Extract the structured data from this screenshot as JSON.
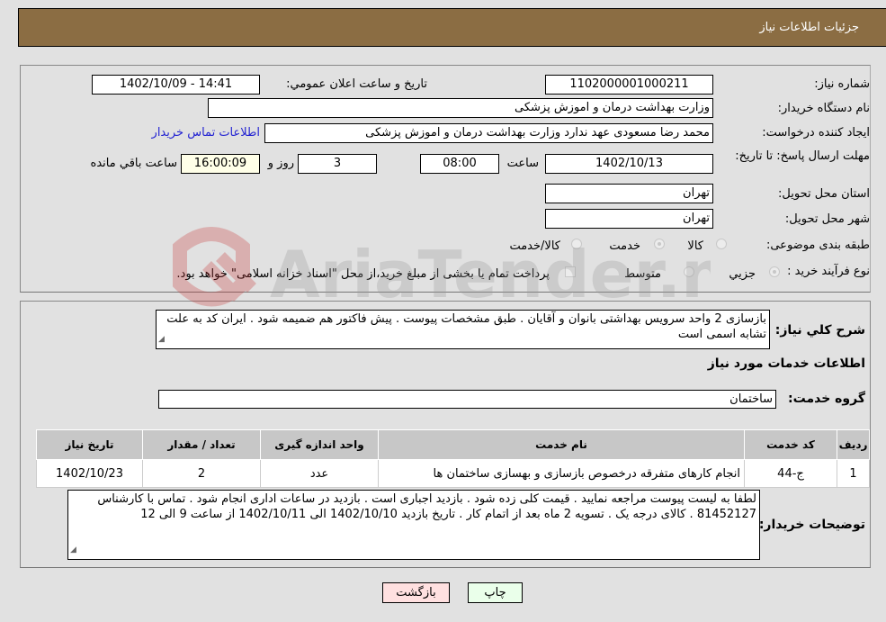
{
  "header": {
    "title": "جزئیات اطلاعات نیاز"
  },
  "form": {
    "need_number": {
      "label": "شماره نیاز:",
      "value": "1102000001000211"
    },
    "announce": {
      "label": "تاریخ و ساعت اعلان عمومي:",
      "value": "1402/10/09 - 14:41"
    },
    "buyer_org": {
      "label": "نام دستگاه خريدار:",
      "value": "وزارت بهداشت  درمان و اموزش پزشکی"
    },
    "requester": {
      "label": "ایجاد کننده درخواست:",
      "value": "محمد رضا مسعودی عهد ندارد وزارت بهداشت  درمان و اموزش پزشکی",
      "contact_link": "اطلاعات تماس خریدار"
    },
    "deadline": {
      "label": "مهلت ارسال پاسخ: تا تاریخ:",
      "date": "1402/10/13",
      "time_label": "ساعت",
      "time": "08:00",
      "days": "3",
      "days_label": "روز و",
      "remaining": "16:00:09",
      "remaining_label": "ساعت باقي مانده"
    },
    "province": {
      "label": "استان محل تحویل:",
      "value": "تهران"
    },
    "city": {
      "label": "شهر محل تحویل:",
      "value": "تهران"
    },
    "category": {
      "label": "طبقه بندی موضوعی:",
      "options": [
        "کالا",
        "خدمت",
        "کالا/خدمت"
      ],
      "selected": "خدمت"
    },
    "purchase_type": {
      "label": "نوع فرآیند خرید :",
      "options": [
        "جزيي",
        "متوسط"
      ],
      "selected": "جزيي",
      "treasury_note": "پرداخت تمام یا بخشی از مبلغ خرید،از محل \"اسناد خزانه اسلامی\" خواهد بود."
    }
  },
  "description": {
    "label": "شرح کلي نياز:",
    "value": "بازسازی 2 واحد سرویس بهداشتی بانوان و آقایان  . طبق مشخصات پیوست . پیش فاکتور هم ضمیمه شود . ایران کد به علت تشابه اسمی است"
  },
  "services_section": {
    "title": "اطلاعات خدمات مورد نياز",
    "group_label": "گروه خدمت:",
    "group_value": "ساختمان"
  },
  "table": {
    "headers": [
      "رديف",
      "کد خدمت",
      "نام خدمت",
      "واحد اندازه گيری",
      "تعداد / مقدار",
      "تاريخ نياز"
    ],
    "rows": [
      [
        "1",
        "ج-44",
        "انجام کارهای متفرقه درخصوص بازسازی و بهسازی ساختمان ها",
        "عدد",
        "2",
        "1402/10/23"
      ]
    ]
  },
  "buyer_notes": {
    "label": "توضيحات خريدار:",
    "value": "لطفا به لیست پیوست مراجعه نمایید . قیمت کلی زده شود . بازدید اجباری است . بازدید در ساعات اداری انجام شود . تماس با کارشناس 81452127 . کالای درجه یک . تسویه 2 ماه بعد از اتمام کار . تاریخ بازدید 1402/10/10 الی 1402/10/11 از ساعت 9 الی 12"
  },
  "buttons": {
    "print": "چاپ",
    "back": "بازگشت"
  },
  "watermark": {
    "text": "AriaTender.neT"
  },
  "colors": {
    "header_bg": "#8b6d43",
    "link": "#2323d2",
    "print_bg": "#eaffea",
    "back_bg": "#ffe0e0",
    "remaining_bg": "#ffffe8"
  }
}
